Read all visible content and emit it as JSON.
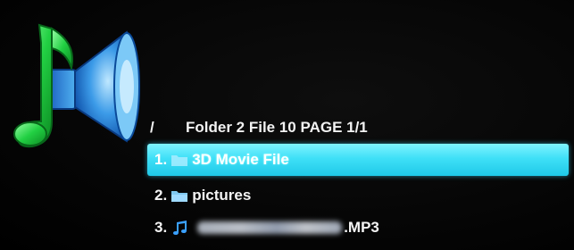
{
  "header": {
    "path": "/",
    "info": "Folder 2 File 10 PAGE 1/1"
  },
  "colors": {
    "highlight": "#3fe0f7",
    "folder_icon": "#7fc8f0",
    "music_icon": "#3aa0ff",
    "speaker_blue": "#2f8fe0",
    "note_green": "#2fd84a"
  },
  "items": [
    {
      "number": "1.",
      "icon": "folder-icon",
      "label": "3D Movie File",
      "selected": true
    },
    {
      "number": "2.",
      "icon": "folder-icon",
      "label": "pictures",
      "selected": false
    },
    {
      "number": "3.",
      "icon": "music-note-icon",
      "label": ".MP3",
      "selected": false
    }
  ]
}
